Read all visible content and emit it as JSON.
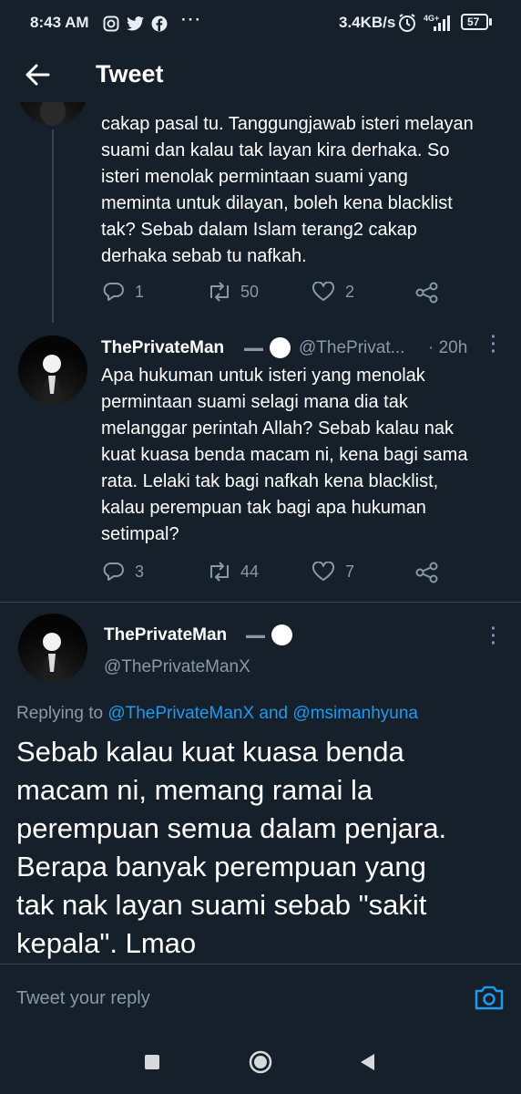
{
  "status_bar": {
    "time": "8:43 AM",
    "speed": "3.4KB/s",
    "network": "4G+",
    "battery": "57"
  },
  "header": {
    "title": "Tweet"
  },
  "tweet1": {
    "text_lines": [
      "cakap pasal tu. Tanggungjawab isteri melayan",
      "suami dan kalau tak layan kira derhaka. So",
      "isteri menolak permintaan suami yang",
      "meminta untuk dilayan, boleh kena blacklist",
      "tak? Sebab dalam Islam terang2 cakap",
      "derhaka sebab tu nafkah."
    ],
    "replies": "1",
    "retweets": "50",
    "likes": "2"
  },
  "tweet2": {
    "name": "ThePrivateMan",
    "handle": "@ThePrivat...",
    "time": "· 20h",
    "text_lines": [
      "Apa hukuman untuk isteri yang menolak",
      "permintaan suami selagi mana dia tak",
      "melanggar perintah Allah? Sebab kalau nak",
      "kuat kuasa benda macam ni, kena bagi sama",
      "rata. Lelaki tak bagi nafkah kena blacklist,",
      "kalau perempuan tak bagi apa hukuman",
      "setimpal?"
    ],
    "replies": "3",
    "retweets": "44",
    "likes": "7"
  },
  "main_tweet": {
    "name": "ThePrivateMan",
    "handle": "@ThePrivateManX",
    "replying_prefix": "Replying to ",
    "replying_to_1": "@ThePrivateManX",
    "replying_and": " and ",
    "replying_to_2": "@msimanhyuna",
    "text_lines": [
      "Sebab kalau kuat kuasa benda",
      "macam ni, memang ramai la",
      "perempuan semua dalam penjara.",
      "Berapa banyak perempuan yang",
      "tak nak layan suami sebab \"sakit",
      "kepala\". Lmao"
    ]
  },
  "reply_box": {
    "placeholder": "Tweet your reply"
  },
  "colors": {
    "background": "#15202b",
    "accent": "#1d9bf0",
    "muted": "#8899a6",
    "divider": "#38444d"
  }
}
